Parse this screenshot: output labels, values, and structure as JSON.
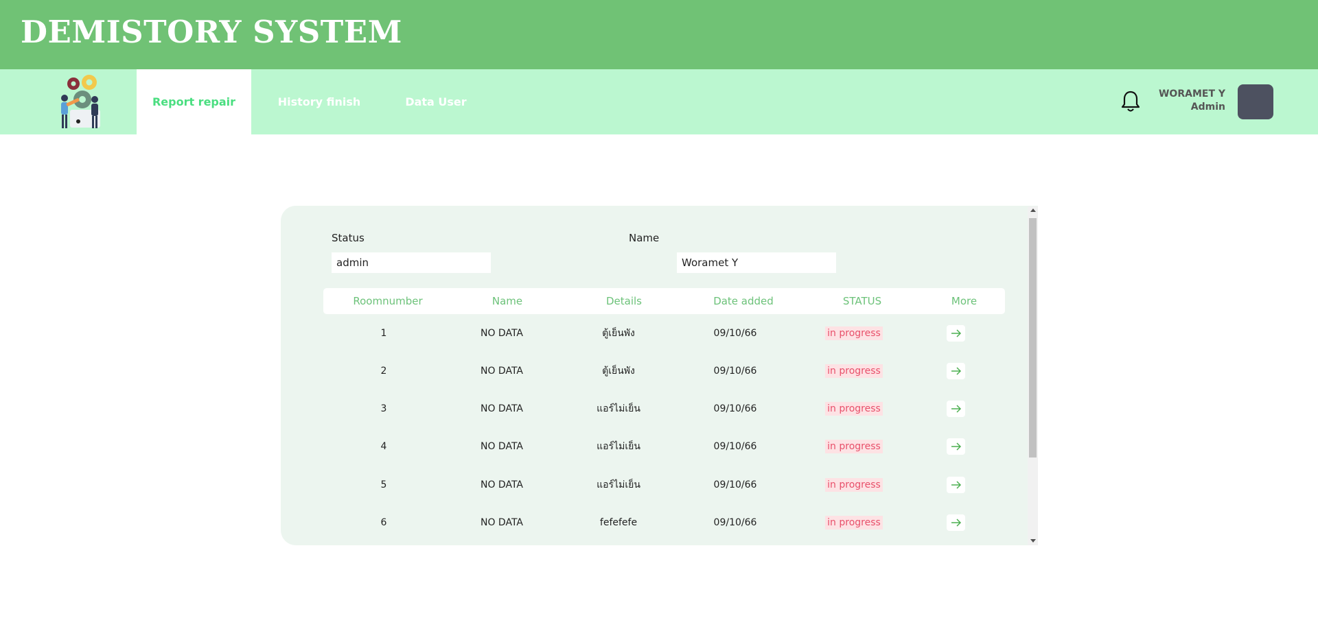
{
  "app": {
    "title": "DEMISTORY SYSTEM"
  },
  "nav": {
    "tabs": [
      {
        "label": "Report repair",
        "active": true
      },
      {
        "label": "History finish",
        "active": false
      },
      {
        "label": "Data User",
        "active": false
      }
    ]
  },
  "user": {
    "name": "WORAMET Y",
    "role": "Admin"
  },
  "filters": {
    "status_label": "Status",
    "status_value": "admin",
    "name_label": "Name",
    "name_value": "Woramet Y"
  },
  "table": {
    "headers": [
      "Roomnumber",
      "Name",
      "Details",
      "Date added",
      "STATUS",
      "More"
    ],
    "rows": [
      {
        "room": "1",
        "name": "NO DATA",
        "details": "ตู้เย็นพัง",
        "date": "09/10/66",
        "status": "in progress"
      },
      {
        "room": "2",
        "name": "NO DATA",
        "details": "ตู้เย็นพัง",
        "date": "09/10/66",
        "status": "in progress"
      },
      {
        "room": "3",
        "name": "NO DATA",
        "details": "แอร์ไม่เย็น",
        "date": "09/10/66",
        "status": "in progress"
      },
      {
        "room": "4",
        "name": "NO DATA",
        "details": "แอร์ไม่เย็น",
        "date": "09/10/66",
        "status": "in progress"
      },
      {
        "room": "5",
        "name": "NO DATA",
        "details": "แอร์ไม่เย็น",
        "date": "09/10/66",
        "status": "in progress"
      },
      {
        "room": "6",
        "name": "NO DATA",
        "details": "fefefefe",
        "date": "09/10/66",
        "status": "in progress"
      }
    ]
  },
  "colors": {
    "header_green": "#70c275",
    "nav_mint": "#bbf7d0",
    "active_tab_text": "#4ade80",
    "panel_bg": "#ecf5ef",
    "status_text": "#e8506a",
    "status_bg": "#fde2e4",
    "avatar": "#4d5160"
  },
  "icons": {
    "logo": "repair-team-illustration",
    "notifications": "bell-icon",
    "more": "arrow-right-icon"
  }
}
